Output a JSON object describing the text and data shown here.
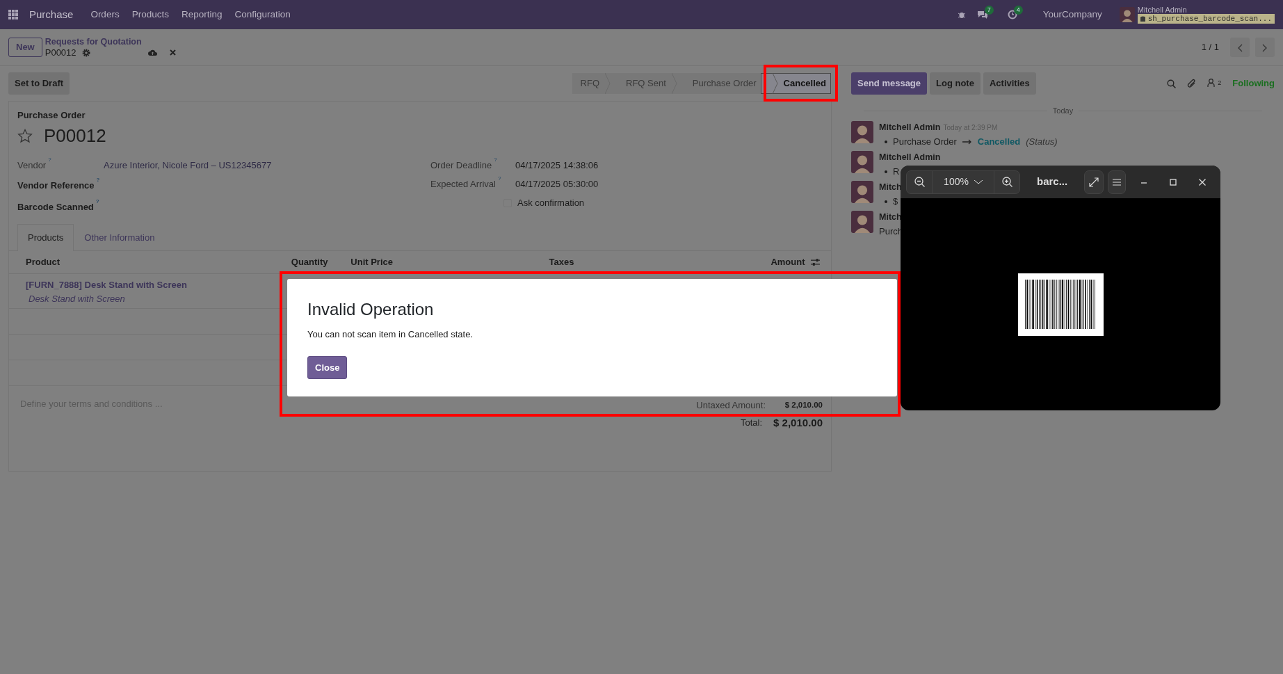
{
  "navbar": {
    "app": "Purchase",
    "menu": [
      "Orders",
      "Products",
      "Reporting",
      "Configuration"
    ],
    "chat_count": "7",
    "activity_count": "4",
    "company": "YourCompany",
    "user": "Mitchell Admin",
    "database": "sh_purchase_barcode_scan..."
  },
  "control_panel": {
    "new_button": "New",
    "breadcrumb": "Requests for Quotation",
    "record": "P00012",
    "pager": "1 / 1"
  },
  "statusbar": {
    "buttons": [
      "Set to Draft"
    ],
    "stages": [
      {
        "label": "RFQ",
        "selected": false
      },
      {
        "label": "RFQ Sent",
        "selected": false
      },
      {
        "label": "Purchase Order",
        "selected": false
      },
      {
        "label": "Cancelled",
        "selected": true
      }
    ]
  },
  "form": {
    "caption": "Purchase Order",
    "name": "P00012",
    "starred": false,
    "fields_left": [
      {
        "label": "Vendor",
        "help": "?",
        "value": "Azure Interior, Nicole Ford – US12345677",
        "strong": false
      },
      {
        "label": "Vendor Reference",
        "help": "?",
        "strong": true
      },
      {
        "label": "Barcode Scanned",
        "help": "?",
        "strong": true
      }
    ],
    "fields_right": [
      {
        "label": "Order Deadline",
        "help": "?",
        "value": "04/17/2025 14:38:06"
      },
      {
        "label": "Expected Arrival",
        "help": "?",
        "value": "04/17/2025 05:30:00"
      }
    ],
    "ask_confirmation": {
      "label": "Ask confirmation",
      "checked": false
    },
    "tabs": [
      {
        "label": "Products",
        "selected": true
      },
      {
        "label": "Other Information",
        "selected": false
      }
    ],
    "table": {
      "columns": [
        "Product",
        "Quantity",
        "Unit Price",
        "Taxes",
        "Amount"
      ],
      "rows": [
        {
          "product": "[FURN_7888] Desk Stand with Screen",
          "description": "Desk Stand with Screen"
        }
      ]
    },
    "terms_placeholder": "Define your terms and conditions ...",
    "totals": [
      {
        "kind": "subtotal",
        "label": "Untaxed Amount:",
        "value": "$ 2,010.00"
      },
      {
        "kind": "total",
        "label": "Total:",
        "value": "$ 2,010.00"
      }
    ]
  },
  "chatter": {
    "buttons": [
      {
        "label": "Send message",
        "selected": true
      },
      {
        "label": "Log note",
        "selected": false
      },
      {
        "label": "Activities",
        "selected": false
      }
    ],
    "followers": "2",
    "following": "Following",
    "day": "Today",
    "messages": [
      {
        "author": "Mitchell Admin",
        "time": "Today at 2:39 PM",
        "kind": "tracking",
        "old": "Purchase Order",
        "new": "Cancelled",
        "field": "(Status)"
      },
      {
        "author": "Mitchell Admin",
        "kind": "bullet",
        "text": "R"
      },
      {
        "author": "Mitch",
        "kind": "bullet",
        "text": "$"
      },
      {
        "author": "Mitch",
        "kind": "plain",
        "text": "Purch"
      }
    ]
  },
  "dialog": {
    "title": "Invalid Operation",
    "body": "You can not scan item in Cancelled state.",
    "button": "Close"
  },
  "viewer": {
    "zoom": "100%",
    "title": "barc..."
  }
}
